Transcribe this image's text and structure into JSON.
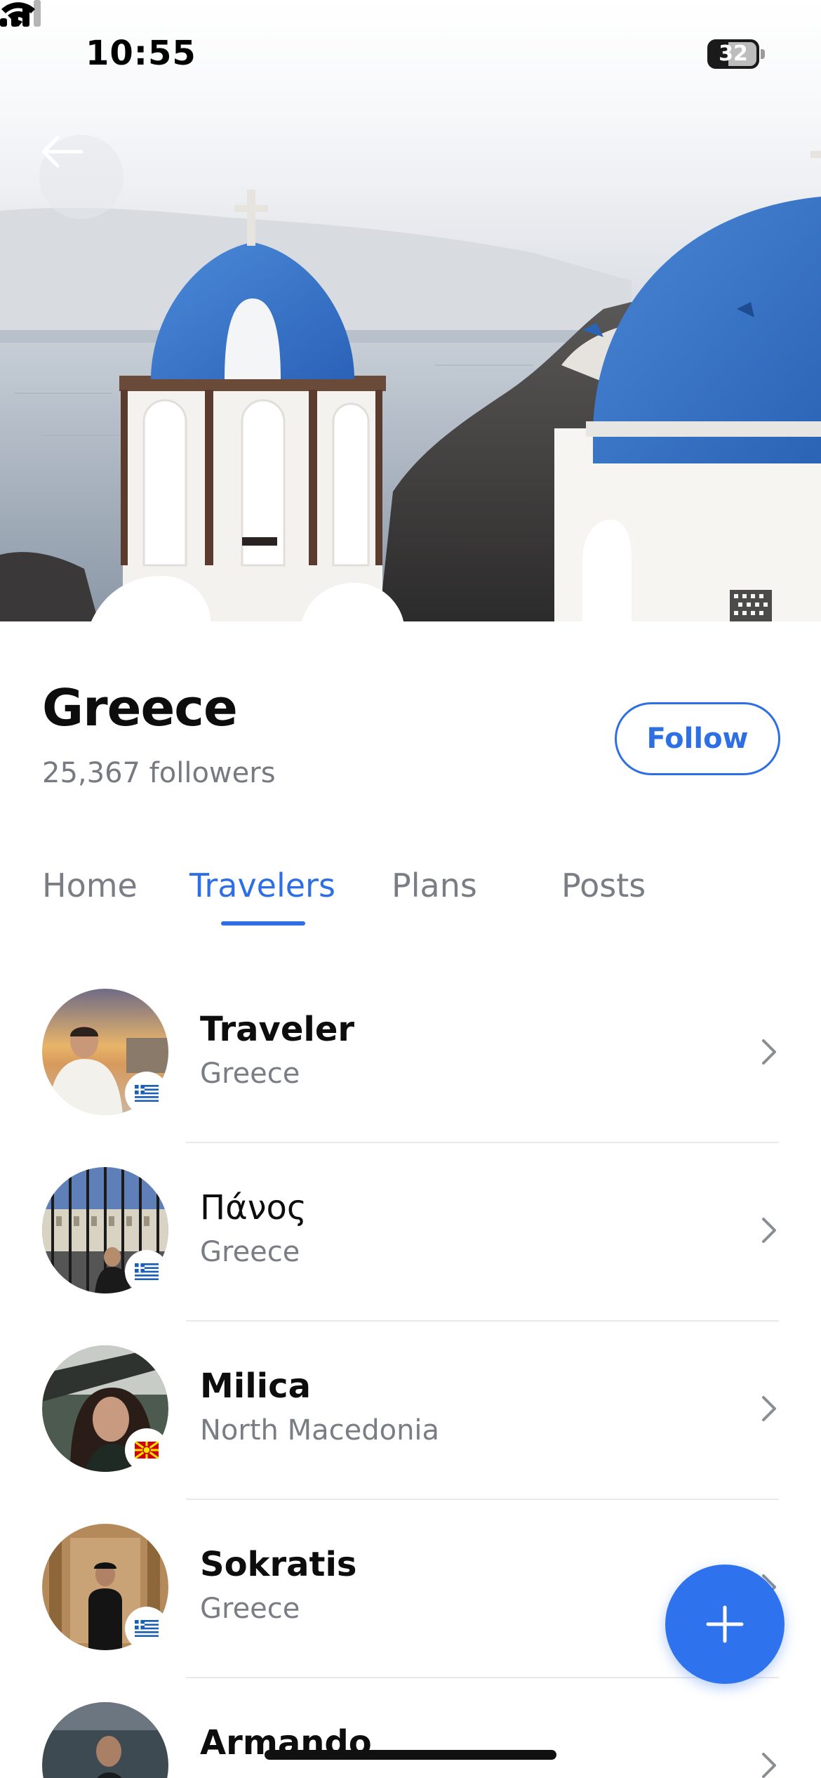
{
  "status_bar": {
    "time": "10:55",
    "battery": "32",
    "icons": [
      "signal-icon",
      "wifi-icon",
      "battery-icon"
    ]
  },
  "hero": {
    "image": "santorini-blue-domes"
  },
  "header": {
    "title": "Greece",
    "followers": "25,367 followers",
    "follow_label": "Follow"
  },
  "tabs": [
    {
      "label": "Home",
      "active": false
    },
    {
      "label": "Travelers",
      "active": true
    },
    {
      "label": "Plans",
      "active": false
    },
    {
      "label": "Posts",
      "active": false
    }
  ],
  "travelers": [
    {
      "name": "Traveler",
      "country": "Greece",
      "flag": "greece-flag-icon"
    },
    {
      "name": "Πάνος",
      "country": "Greece",
      "flag": "greece-flag-icon"
    },
    {
      "name": "Milica",
      "country": "North Macedonia",
      "flag": "north-macedonia-flag-icon"
    },
    {
      "name": "Sokratis",
      "country": "Greece",
      "flag": "greece-flag-icon"
    },
    {
      "name": "Armando",
      "country": "",
      "flag": ""
    }
  ],
  "colors": {
    "accent": "#2f6fe6",
    "muted_text": "#7a7d83",
    "dome_blue": "#2f6fc2"
  }
}
